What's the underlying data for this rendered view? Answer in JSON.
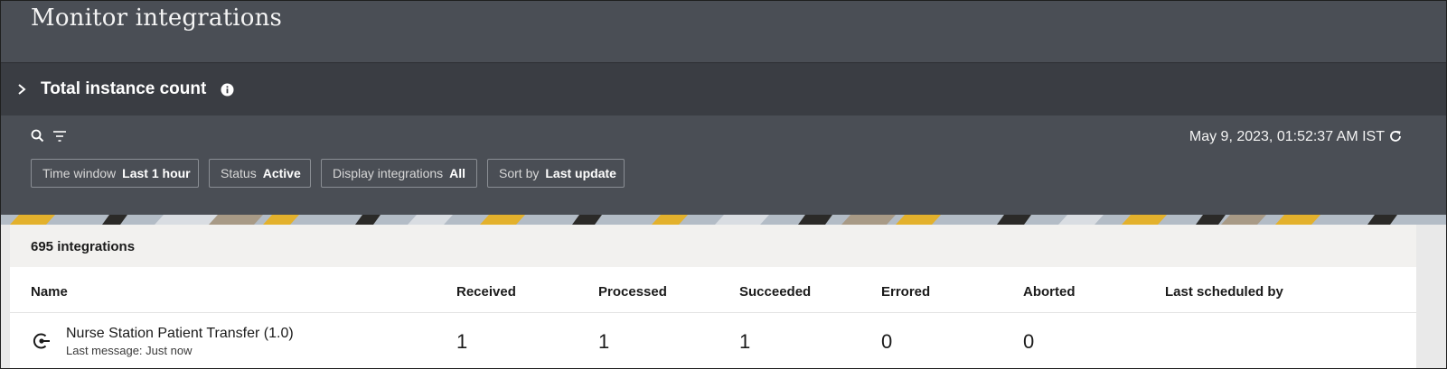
{
  "page": {
    "title": "Monitor integrations"
  },
  "summary": {
    "title": "Total instance count",
    "expand_icon": "chevron-right-icon",
    "info_icon": "info-icon"
  },
  "toolbar": {
    "search_icon": "search-icon",
    "filter_icon": "filter-icon",
    "timestamp": "May 9, 2023, 01:52:37 AM IST",
    "refresh_icon": "refresh-icon"
  },
  "chips": [
    {
      "label": "Time window",
      "value": "Last 1 hour"
    },
    {
      "label": "Status",
      "value": "Active"
    },
    {
      "label": "Display integrations",
      "value": "All"
    },
    {
      "label": "Sort by",
      "value": "Last update"
    }
  ],
  "list": {
    "count": "695 integrations",
    "columns": [
      "Name",
      "Received",
      "Processed",
      "Succeeded",
      "Errored",
      "Aborted",
      "Last scheduled by"
    ],
    "rows": [
      {
        "name": "Nurse Station Patient Transfer (1.0)",
        "last_message": "Last message: Just now",
        "received": "1",
        "processed": "1",
        "succeeded": "1",
        "errored": "0",
        "aborted": "0",
        "last_scheduled_by": "",
        "icon": "integration-pattern-icon"
      }
    ]
  },
  "colors": {
    "header_bg": "#4a4e55",
    "summary_bg": "#3a3d43",
    "list_header_bg": "#f2f1ef",
    "banner_accent": "#e3b12c"
  }
}
